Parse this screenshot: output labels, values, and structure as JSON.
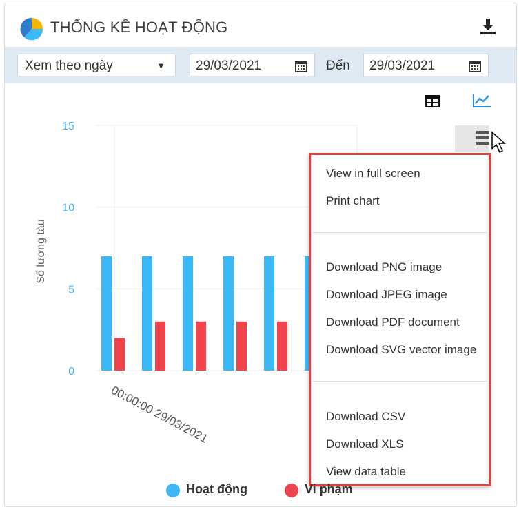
{
  "header": {
    "title": "THỐNG KÊ HOẠT ĐỘNG"
  },
  "filters": {
    "mode_value": "Xem theo ngày",
    "from_date": "29/03/2021",
    "to_label": "Đến",
    "to_date": "29/03/2021"
  },
  "colors": {
    "series_active": "#3cb8f6",
    "series_violation": "#f0444c",
    "accent_blue": "#2f8fe0",
    "menu_border": "#e34040"
  },
  "context_menu": {
    "items": [
      "View in full screen",
      "Print chart",
      "Download PNG image",
      "Download JPEG image",
      "Download PDF document",
      "Download SVG vector image",
      "Download CSV",
      "Download XLS",
      "View data table"
    ]
  },
  "chart_data": {
    "type": "bar",
    "ylabel": "Số lượng tàu",
    "ylim": [
      0,
      15
    ],
    "yticks": [
      "0",
      "5",
      "10",
      "15"
    ],
    "xtick_label": "00:00:00 29/03/2021",
    "series": [
      {
        "name": "Hoạt động",
        "values": [
          7,
          7,
          7,
          7,
          7,
          7
        ]
      },
      {
        "name": "Vi phạm",
        "values": [
          2,
          3,
          3,
          3,
          3
        ]
      }
    ],
    "grid": true,
    "legend_position": "bottom"
  },
  "legend": {
    "item1": "Hoạt động",
    "item2": "Vi phạm"
  }
}
